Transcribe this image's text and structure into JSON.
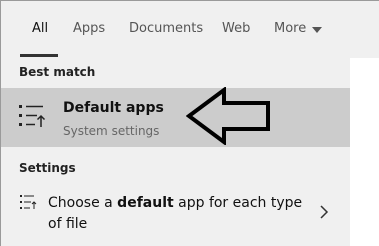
{
  "tabs": [
    {
      "label": "All",
      "active": true
    },
    {
      "label": "Apps",
      "active": false
    },
    {
      "label": "Documents",
      "active": false
    },
    {
      "label": "Web",
      "active": false
    },
    {
      "label": "More",
      "active": false
    }
  ],
  "sections": {
    "best_match": "Best match",
    "settings": "Settings"
  },
  "best_match_item": {
    "title": "Default apps",
    "subtitle": "System settings",
    "icon": "settings-list-icon"
  },
  "settings_item": {
    "text_before": "Choose a ",
    "text_bold": "default",
    "text_after": " app for each type of file",
    "icon": "settings-list-icon"
  },
  "colors": {
    "selected_row": "#cccccc",
    "panel": "#f0f0f0"
  }
}
